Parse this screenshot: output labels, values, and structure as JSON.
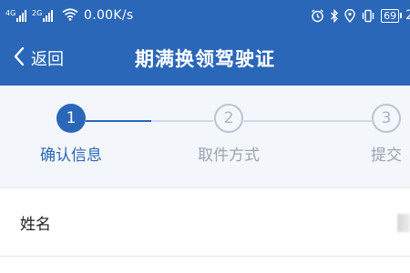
{
  "status_bar": {
    "signal1_tag": "4G",
    "signal2_tag": "2G",
    "net_speed": "0.00K/s",
    "battery": "69",
    "clock_partial": "2"
  },
  "header": {
    "back_label": "返回",
    "title": "期满换领驾驶证"
  },
  "colors": {
    "brand": "#2a67b8",
    "stepper_bg": "#f3f6fa",
    "pending": "#9aa4b1"
  },
  "steps": [
    {
      "number": "1",
      "label": "确认信息",
      "state": "active"
    },
    {
      "number": "2",
      "label": "取件方式",
      "state": "pending"
    },
    {
      "number": "3",
      "label": "提交",
      "state": "pending"
    }
  ],
  "form": {
    "name_label": "姓名",
    "name_value_masked": "blurred"
  }
}
